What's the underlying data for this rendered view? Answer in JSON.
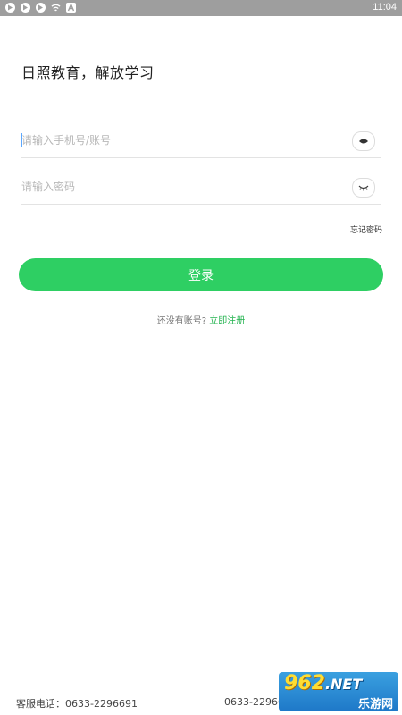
{
  "status_bar": {
    "time": "11:04",
    "icons": [
      "play-store-icon",
      "play-store-icon",
      "play-store-icon",
      "wifi-icon",
      "a-icon"
    ]
  },
  "slogan": "日照教育，解放学习",
  "phone_field": {
    "placeholder": "请输入手机号/账号",
    "value": ""
  },
  "password_field": {
    "placeholder": "请输入密码",
    "value": ""
  },
  "forgot_password": "忘记密码",
  "login_button": "登录",
  "register": {
    "prompt": "还没有账号?",
    "link": "立即注册"
  },
  "footer": {
    "service_hotline": "客服电话：0633-2296691",
    "hotline_repeat": "0633-22966"
  },
  "watermark": {
    "top": "962",
    "suffix": ".NET",
    "bottom": "乐游网"
  },
  "colors": {
    "accent": "#2ecf63",
    "link": "#23b34f",
    "status_bar": "#9e9e9e"
  }
}
